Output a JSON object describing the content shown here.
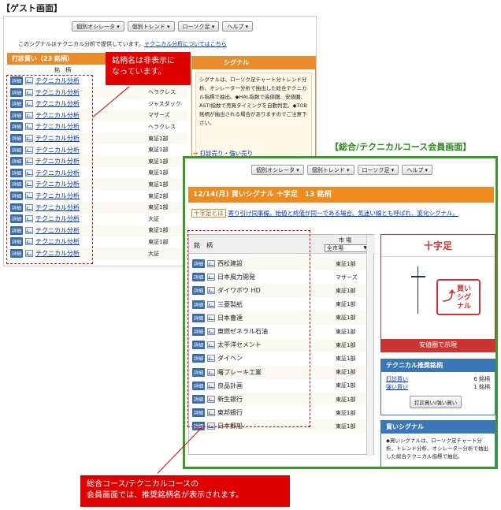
{
  "labels": {
    "guest_title": "【ゲスト画面】",
    "member_title": "【総合/テクニカルコース会員画面】",
    "callout_top": "銘柄名は非表示に\nなっています。",
    "callout_bottom": "総合コース/テクニカルコースの\n会員画面では、推奨銘柄名が表示されます。"
  },
  "nav": {
    "items": [
      "個別オシレータ ▾",
      "個別トレンド ▾",
      "ローソク足 ▾",
      "ヘルプ ▾"
    ]
  },
  "guest": {
    "notice_text": "このシグナルはテクニカル分析で提供しています。",
    "notice_link": "テクニカル分析についてはこちら",
    "section_header": "打診買い（23 銘柄）",
    "col_header": "銘　柄",
    "detail_label": "詳細",
    "row_link": "テクニカル分析",
    "rows": [
      {
        "market": ""
      },
      {
        "market": "ヘラクレス"
      },
      {
        "market": "ジャスダック"
      },
      {
        "market": "マザーズ"
      },
      {
        "market": "ヘラクレス"
      },
      {
        "market": "東証1部"
      },
      {
        "market": "東証1部"
      },
      {
        "market": "東証1部"
      },
      {
        "market": "東証1部"
      },
      {
        "market": "東証1部"
      },
      {
        "market": "東証2部"
      },
      {
        "market": "東証1部"
      },
      {
        "market": "大証"
      },
      {
        "market": "東証1部"
      },
      {
        "market": "東証1部"
      },
      {
        "market": "大証"
      }
    ],
    "right_header": "シグナル",
    "right_body": "シグナルは、ローソク足チャート分トレンド分析、オシレーター分析で抽出した総合テクニカル指標で抽出。◆HAL指数で高値圏、安値圏、ASTI指数で売買タイミングを自動判定。◆TOB銘柄が抽出される場合がありますのでご注意下さい。",
    "right_link": "打診売り・強い売り"
  },
  "member": {
    "title": "12/14(月) 買いシグナル 十字足　13 銘柄",
    "legend_tag": "十字足とは",
    "legend_text": "寄り引け同事線。始値と終値が同一である場合。気迷い線とも呼ばれ、変化シグナル。",
    "col_name": "銘　柄",
    "col_market": "市 場",
    "select_value": "全市場",
    "detail_label": "詳細",
    "rows": [
      {
        "name": "西松建設",
        "market": "東証1部"
      },
      {
        "name": "日本風力開発",
        "market": "マザーズ"
      },
      {
        "name": "ダイワボウ HD",
        "market": "東証1部"
      },
      {
        "name": "三菱製紙",
        "market": "東証1部"
      },
      {
        "name": "日本曹達",
        "market": "東証1部"
      },
      {
        "name": "東燃ゼネラル石油",
        "market": "東証1部"
      },
      {
        "name": "太平洋セメント",
        "market": "東証1部"
      },
      {
        "name": "ダイヘン",
        "market": "東証1部"
      },
      {
        "name": "曙ブレーキ工業",
        "market": "東証1部"
      },
      {
        "name": "良品計画",
        "market": "東証1部"
      },
      {
        "name": "新生銀行",
        "market": "東証1部"
      },
      {
        "name": "東邦銀行",
        "market": "東証1部"
      },
      {
        "name": "日本郵船",
        "market": "東証1部"
      }
    ],
    "cross_title": "十字足",
    "cross_badge": "買い\nシグ\nナル",
    "cross_foot": "安値圏で示現",
    "rec_title": "テクニカル推奨銘柄",
    "rec_rows": [
      {
        "label": "打診買い",
        "count": "6 銘柄"
      },
      {
        "label": "強い買い",
        "count": "1 銘柄"
      }
    ],
    "rec_button": "打診買い/強い買い",
    "buy_title": "買いシグナル",
    "buy_body": "◆買いシグナルは、ローソク足チャート分析、トレンド分析、オシレーター分析で抽出した総合テクニカル指標で抽出。"
  },
  "colors": {
    "orange": "#f08a1c",
    "green_frame": "#3a9a2a",
    "red": "#e00000",
    "blue_header": "#3a77b8"
  }
}
